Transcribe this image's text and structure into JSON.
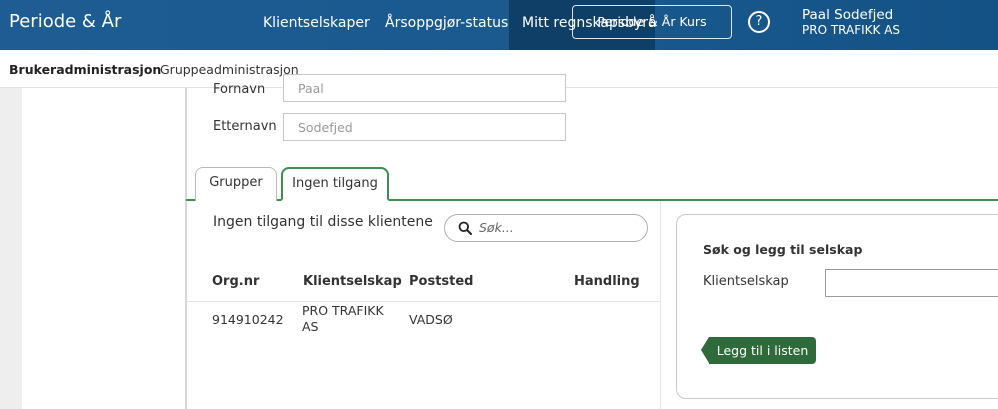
{
  "app": {
    "brand": "Periode & År"
  },
  "nav": {
    "items": [
      "Klientselskaper",
      "Årsoppgjør-status",
      "Mitt regnskapsbyrå"
    ],
    "kurs_button": "Periode & År Kurs",
    "help": "?"
  },
  "user": {
    "name": "Paal Sodefjed",
    "company": "PRO TRAFIKK AS"
  },
  "subnav": {
    "items": [
      "Brukeradministrasjon",
      "Gruppeadministrasjon"
    ],
    "active": "Brukeradministrasjon"
  },
  "form": {
    "fornavn_label": "Fornavn",
    "fornavn_value": "Paal",
    "etternavn_label": "Etternavn",
    "etternavn_value": "Sodefjed"
  },
  "tabs": [
    "Grupper",
    "Ingen tilgang"
  ],
  "active_tab": "Ingen tilgang",
  "no_access": {
    "title": "Ingen tilgang til disse klientene",
    "search_placeholder": "Søk...",
    "columns": [
      "Org.nr",
      "Klientselskap",
      "Poststed",
      "Handling"
    ],
    "rows": [
      {
        "orgnr": "914910242",
        "klientselskap": "PRO TRAFIKK AS",
        "poststed": "VADSØ",
        "handling": ""
      }
    ]
  },
  "add_panel": {
    "title": "Søk og legg til selskap",
    "label": "Klientselskap",
    "input_value": "",
    "button": "Legg til i listen"
  },
  "colors": {
    "primary": "#1e5c93",
    "accent_green": "#2f6a3a",
    "tab_border": "#3e8e4f"
  }
}
